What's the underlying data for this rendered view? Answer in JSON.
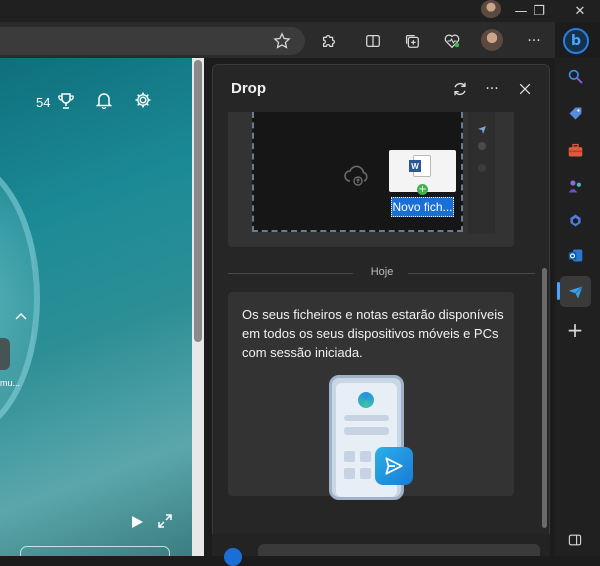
{
  "browser": {
    "window_controls": {
      "minimize": "—",
      "restore": "❐",
      "close": "✕"
    },
    "toolbar_more": "···",
    "bing_label": "b"
  },
  "webpage": {
    "points": "54",
    "truncated_label": "mu..."
  },
  "drop_pane": {
    "title": "Drop",
    "more": "···",
    "file_label": "Novo fich...",
    "file_app": "W",
    "divider_label": "Hoje",
    "info_text": "Os seus ficheiros e notas estarão disponíveis em todos os seus dispositivos móveis e PCs com sessão iniciada."
  },
  "sidebar": {
    "add": "+"
  },
  "colors": {
    "accent": "#4aa3ff",
    "file_label_bg": "#1a6fd6",
    "pane_bg": "#262626",
    "card_bg": "#333333"
  }
}
